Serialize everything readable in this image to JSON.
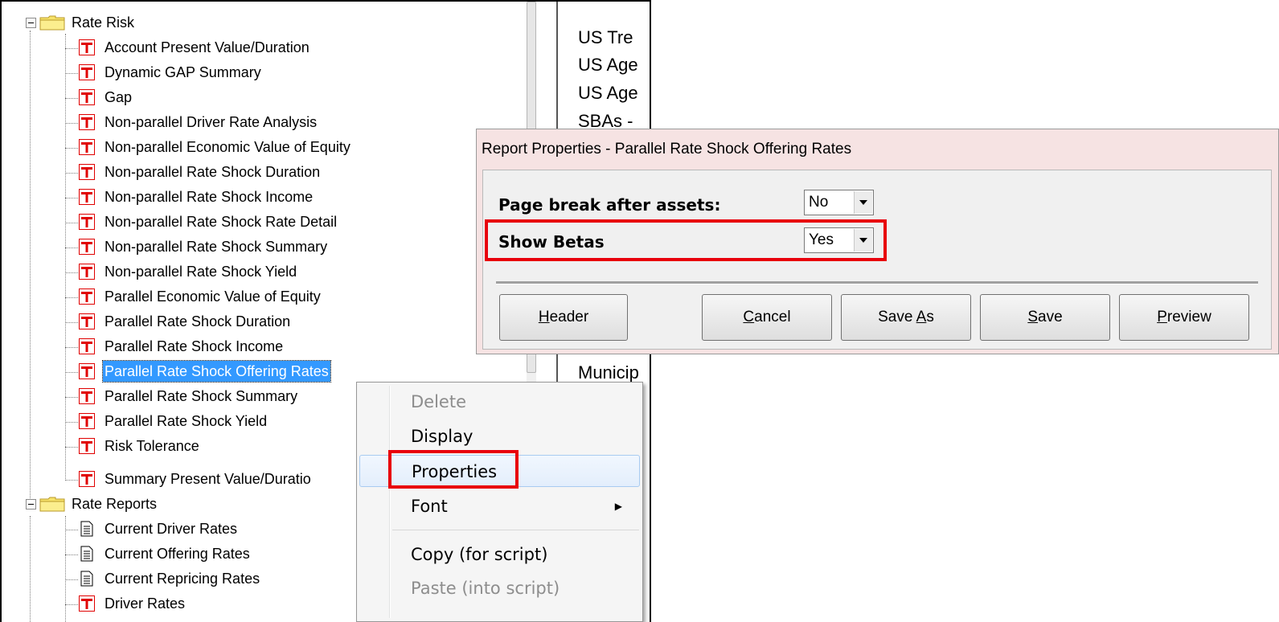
{
  "tree": {
    "folders": [
      {
        "label": "Rate Risk",
        "items": [
          {
            "label": "Account Present Value/Duration",
            "icon": "report-icon"
          },
          {
            "label": "Dynamic GAP Summary",
            "icon": "report-icon"
          },
          {
            "label": "Gap",
            "icon": "report-icon"
          },
          {
            "label": "Non-parallel Driver Rate Analysis",
            "icon": "report-icon"
          },
          {
            "label": "Non-parallel Economic Value of Equity",
            "icon": "report-icon"
          },
          {
            "label": "Non-parallel Rate Shock Duration",
            "icon": "report-icon"
          },
          {
            "label": "Non-parallel Rate Shock Income",
            "icon": "report-icon"
          },
          {
            "label": "Non-parallel Rate Shock Rate Detail",
            "icon": "report-icon"
          },
          {
            "label": "Non-parallel Rate Shock Summary",
            "icon": "report-icon"
          },
          {
            "label": "Non-parallel Rate Shock Yield",
            "icon": "report-icon"
          },
          {
            "label": "Parallel Economic Value of Equity",
            "icon": "report-icon"
          },
          {
            "label": "Parallel Rate Shock Duration",
            "icon": "report-icon"
          },
          {
            "label": "Parallel Rate Shock Income",
            "icon": "report-icon"
          },
          {
            "label": "Parallel Rate Shock Offering Rates",
            "icon": "report-icon"
          },
          {
            "label": "Parallel Rate Shock Summary",
            "icon": "report-icon"
          },
          {
            "label": "Parallel Rate Shock Yield",
            "icon": "report-icon"
          },
          {
            "label": "Risk Tolerance",
            "icon": "report-icon"
          },
          {
            "label": "Summary Present Value/Duratio",
            "icon": "report-icon"
          }
        ]
      },
      {
        "label": "Rate Reports",
        "items": [
          {
            "label": "Current Driver Rates",
            "icon": "document-icon"
          },
          {
            "label": "Current Offering Rates",
            "icon": "document-icon"
          },
          {
            "label": "Current Repricing Rates",
            "icon": "document-icon"
          },
          {
            "label": "Driver Rates",
            "icon": "report-icon"
          }
        ]
      }
    ]
  },
  "side_list": {
    "items": [
      "US Tre",
      "US Age",
      "US Age",
      "SBAs -",
      "Municip"
    ]
  },
  "context_menu": {
    "delete": "Delete",
    "display": "Display",
    "properties": "Properties",
    "font": "Font",
    "copy": "Copy (for script)",
    "paste": "Paste (into script)"
  },
  "dialog": {
    "title": "Report Properties - Parallel Rate Shock Offering Rates",
    "page_break": {
      "label": "Page break after assets:",
      "value": "No"
    },
    "show_betas": {
      "label": "Show Betas",
      "value": "Yes"
    },
    "buttons": {
      "header": {
        "mnemonic": "H",
        "rest": "eader"
      },
      "cancel": {
        "mnemonic": "C",
        "rest": "ancel"
      },
      "save_as": {
        "pre": "Save ",
        "mnemonic": "A",
        "rest": "s"
      },
      "save": {
        "mnemonic": "S",
        "rest": "ave"
      },
      "preview": {
        "mnemonic": "P",
        "rest": "review"
      }
    }
  },
  "colors": {
    "selection": "#3399ff",
    "highlight_box": "#e8000b",
    "report_icon_red": "#e00000",
    "folder_yellow": "#f7e36a",
    "dialog_frame": "#f6e3e3"
  }
}
